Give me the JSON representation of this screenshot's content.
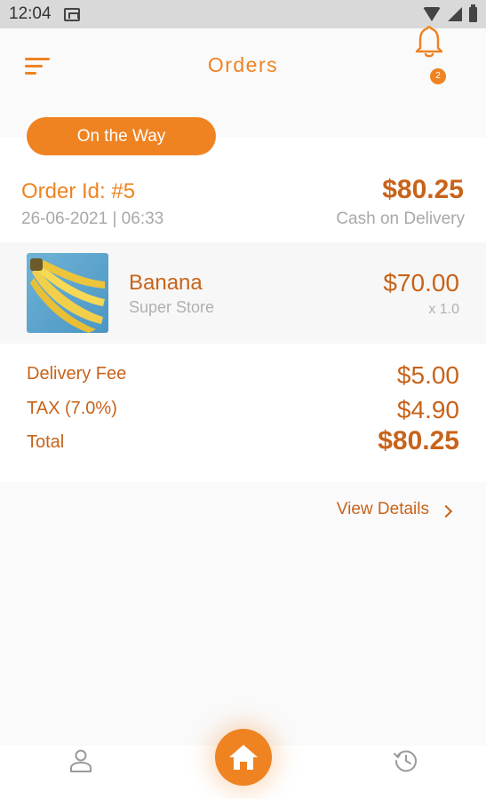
{
  "status_bar": {
    "time": "12:04"
  },
  "header": {
    "title": "Orders",
    "notification_count": "2"
  },
  "order": {
    "status": "On the Way",
    "id_label": "Order Id: #5",
    "date": "26-06-2021 | 06:33",
    "total": "$80.25",
    "payment_method": "Cash on Delivery",
    "items": [
      {
        "name": "Banana",
        "store": "Super Store",
        "price": "$70.00",
        "quantity": "x 1.0"
      }
    ],
    "summary": [
      {
        "label": "Delivery Fee",
        "value": "$5.00"
      },
      {
        "label": "TAX (7.0%)",
        "value": "$4.90"
      },
      {
        "label": "Total",
        "value": "$80.25"
      }
    ],
    "view_details_label": "View Details"
  },
  "bottom_nav": {
    "items": [
      {
        "icon": "profile-icon"
      },
      {
        "icon": "home-icon"
      },
      {
        "icon": "history-icon"
      }
    ]
  },
  "colors": {
    "accent": "#ef8322",
    "accent_dark": "#c8631a",
    "muted": "#a8a8a8"
  }
}
